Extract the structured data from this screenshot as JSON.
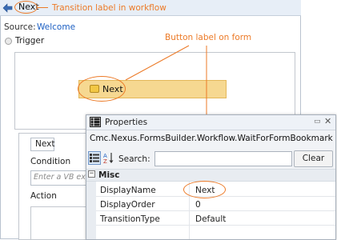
{
  "workflow": {
    "header_label": "Next",
    "header_annotation": "Transition label in workflow",
    "source_label": "Source:",
    "source_value": "Welcome",
    "trigger_label": "Trigger",
    "form_button_label": "Next",
    "form_annotation": "Button label on form",
    "condition_tab": "Next",
    "condition_label": "Condition",
    "condition_placeholder": "Enter a VB exp",
    "action_label": "Action"
  },
  "properties": {
    "title": "Properties",
    "type_name": "Cmc.Nexus.FormsBuilder.Workflow.WaitForFormBookmark",
    "search_label": "Search:",
    "search_value": "",
    "clear_label": "Clear",
    "category": "Misc",
    "rows": [
      {
        "name": "DisplayName",
        "value": "Next"
      },
      {
        "name": "DisplayOrder",
        "value": "0"
      },
      {
        "name": "TransitionType",
        "value": "Default"
      }
    ]
  },
  "colors": {
    "annotation": "#ec7a27",
    "link": "#1c5fc2",
    "highlight_fill": "#f6d891"
  },
  "icons": {
    "transition": "transition-arrow-icon",
    "form_button": "form-button-icon",
    "properties": "properties-window-icon",
    "categorized": "categorized-view-icon",
    "alphabetical": "sort-az-icon",
    "pin": "pin-icon",
    "close": "close-icon"
  }
}
